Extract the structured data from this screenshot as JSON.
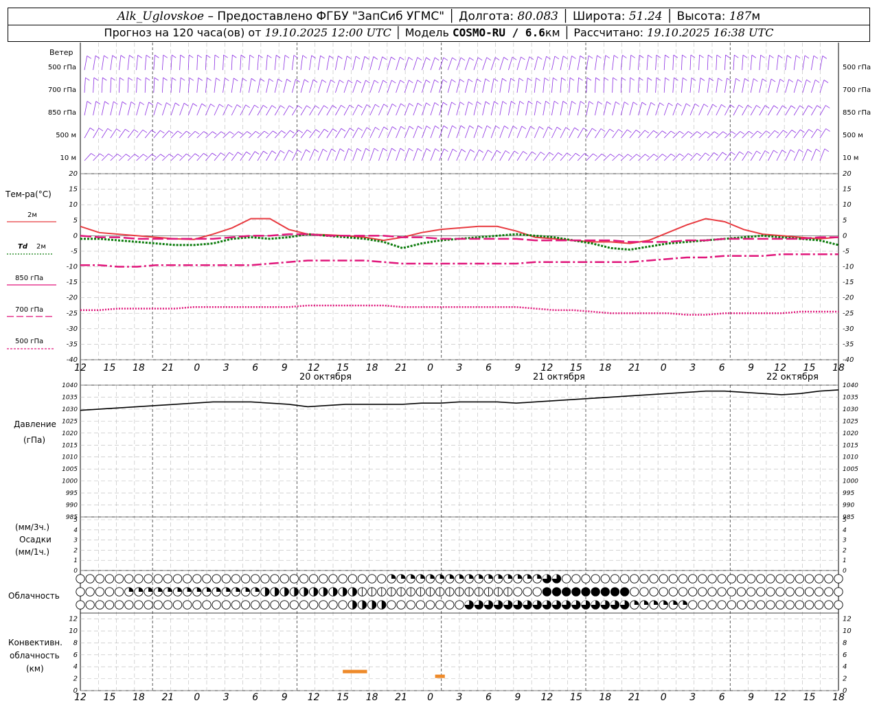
{
  "header": {
    "station": "Alk_Uglovskoe",
    "provider": "– Предоставлено ФГБУ \"ЗапСиб УГМС\"",
    "lon_label": "Долгота:",
    "lon": "80.083",
    "lat_label": "Широта:",
    "lat": "51.24",
    "alt_label": "Высота:",
    "alt": "187",
    "alt_unit": "м",
    "forecast_prefix": "Прогноз на 120 часа(ов) от",
    "run_time": "19.10.2025 12:00 UTC",
    "model_label": "Модель",
    "model": "COSMO-RU / 6.6",
    "model_unit": "км",
    "calc_label": "Рассчитано:",
    "calc_time": "19.10.2025 16:38 UTC"
  },
  "time_axis": {
    "hour_ticks": [
      "12",
      "15",
      "18",
      "21",
      "0",
      "3",
      "6",
      "9",
      "12",
      "15",
      "18",
      "21",
      "0",
      "3",
      "6",
      "9",
      "12",
      "15",
      "18",
      "21",
      "0",
      "3",
      "6",
      "9",
      "12",
      "15",
      "18"
    ],
    "dates": [
      "20 октября",
      "21 октября",
      "22 октября"
    ]
  },
  "wind_panel": {
    "title": "Ветер",
    "levels": [
      "500 гПа",
      "700 гПа",
      "850 гПа",
      "500 м",
      "10 м"
    ]
  },
  "colors": {
    "wind": "#8a2be2",
    "t2m": "#e8393f",
    "td2m": "#0a7a0a",
    "t850": "#e0157a",
    "t700": "#e0157a",
    "t500": "#e0157a",
    "pressure": "#000000",
    "convective": "#ee8a2a",
    "grid": "#b8b8b8"
  },
  "chart_data": [
    {
      "type": "line",
      "title": "Тем-ра(°C)",
      "x_hours": [
        0,
        3,
        6,
        9,
        12,
        15,
        18,
        21,
        24,
        27,
        30,
        33,
        36,
        39,
        42,
        45,
        48,
        51,
        54,
        57,
        60,
        63,
        66,
        69,
        72,
        75,
        78,
        81,
        84,
        87,
        90,
        93,
        96,
        99,
        102,
        105,
        108,
        111,
        114,
        117,
        120
      ],
      "ylim": [
        -40,
        20
      ],
      "yticks": [
        20,
        15,
        10,
        5,
        0,
        -5,
        -10,
        -15,
        -20,
        -25,
        -30,
        -35,
        -40
      ],
      "legend_title": "Тем-ра(°C)",
      "series": [
        {
          "name": "2м",
          "style": "solid",
          "values": [
            3,
            1,
            0.5,
            0,
            -0.5,
            -1,
            -1.2,
            0.5,
            2.5,
            5.5,
            5.5,
            2,
            0.5,
            0.3,
            0,
            -0.5,
            -1.5,
            -0.5,
            1,
            2,
            2.5,
            3,
            3,
            1.5,
            -0.5,
            -1,
            -1.5,
            -2,
            -2,
            -2.5,
            -1.5,
            1,
            3.5,
            5.5,
            4.5,
            2,
            0.5,
            0,
            -0.5,
            -1,
            -0.5
          ]
        },
        {
          "name": "Td 2м",
          "style": "dotted",
          "values": [
            -1,
            -1,
            -1.5,
            -2,
            -2.5,
            -3,
            -3,
            -2.5,
            -1,
            -0.5,
            -1,
            -0.5,
            0.5,
            0,
            -0.5,
            -1,
            -2,
            -4,
            -2.5,
            -1.5,
            -1,
            -0.5,
            0,
            0.5,
            0,
            -0.5,
            -1.5,
            -2.5,
            -4,
            -4.5,
            -3.5,
            -2.5,
            -2,
            -1.5,
            -1,
            -0.5,
            0,
            -0.5,
            -1,
            -1.5,
            -3
          ]
        },
        {
          "name": "850 гПа",
          "style": "dashdot",
          "values": [
            -9.5,
            -9.5,
            -10,
            -10,
            -9.5,
            -9.5,
            -9.5,
            -9.5,
            -9.5,
            -9.5,
            -9,
            -8.5,
            -8,
            -8,
            -8,
            -8,
            -8.5,
            -9,
            -9,
            -9,
            -9,
            -9,
            -9,
            -9,
            -8.5,
            -8.5,
            -8.5,
            -8.5,
            -8.5,
            -8.5,
            -8,
            -7.5,
            -7,
            -7,
            -6.5,
            -6.5,
            -6.5,
            -6,
            -6,
            -6,
            -6
          ]
        },
        {
          "name": "700 гПа",
          "style": "dashed",
          "values": [
            0,
            -0.5,
            -0.5,
            -1,
            -1,
            -1,
            -1,
            -1,
            -0.5,
            0,
            0,
            0.5,
            0.5,
            0,
            0,
            0,
            0,
            -0.5,
            -0.5,
            -1,
            -1,
            -1,
            -1,
            -1,
            -1.5,
            -1.5,
            -1.5,
            -1.5,
            -1.5,
            -2,
            -2,
            -2,
            -1.5,
            -1.5,
            -1,
            -1,
            -1,
            -1,
            -1,
            -0.5,
            -0.5
          ]
        },
        {
          "name": "500 гПа",
          "style": "densedot",
          "values": [
            -24,
            -24,
            -23.5,
            -23.5,
            -23.5,
            -23.5,
            -23,
            -23,
            -23,
            -23,
            -23,
            -23,
            -22.5,
            -22.5,
            -22.5,
            -22.5,
            -22.5,
            -23,
            -23,
            -23,
            -23,
            -23,
            -23,
            -23,
            -23.5,
            -24,
            -24,
            -24.5,
            -25,
            -25,
            -25,
            -25,
            -25.5,
            -25.5,
            -25,
            -25,
            -25,
            -25,
            -24.5,
            -24.5,
            -24.5
          ]
        }
      ]
    },
    {
      "type": "line",
      "title": "Давление",
      "ylabel": "(гПа)",
      "ylim": [
        985,
        1040
      ],
      "yticks": [
        1040,
        1035,
        1030,
        1025,
        1020,
        1015,
        1010,
        1005,
        1000,
        995,
        990,
        985
      ],
      "x_hours": [
        0,
        3,
        6,
        9,
        12,
        15,
        18,
        21,
        24,
        27,
        30,
        33,
        36,
        39,
        42,
        45,
        48,
        51,
        54,
        57,
        60,
        63,
        66,
        69,
        72,
        75,
        78,
        81,
        84,
        87,
        90,
        93,
        96,
        99,
        102,
        105,
        108,
        111,
        114,
        117,
        120
      ],
      "series": [
        {
          "name": "Давление",
          "values": [
            1029.5,
            1030,
            1030.5,
            1031,
            1031.5,
            1032,
            1032.5,
            1033,
            1033,
            1033,
            1032.5,
            1032,
            1031,
            1031.5,
            1032,
            1032,
            1032,
            1032,
            1032.5,
            1032.5,
            1033,
            1033,
            1033,
            1032.5,
            1033,
            1033.5,
            1034,
            1034.5,
            1035,
            1035.5,
            1036,
            1036.5,
            1037,
            1037.5,
            1037.5,
            1037,
            1036.5,
            1036,
            1036.5,
            1037.5,
            1038
          ]
        }
      ]
    },
    {
      "type": "bar",
      "title": "Осадки",
      "units": [
        "(мм/3ч.)",
        "(мм/1ч.)"
      ],
      "ylim": [
        0,
        5
      ],
      "yticks": [
        5,
        4,
        3,
        2,
        1,
        0
      ],
      "values": []
    },
    {
      "type": "table",
      "title": "Облачность",
      "note": "3 rows of hourly cloud cover symbols (0 empty – 8 full), high/middle/low",
      "rows": [
        {
          "segments": [
            [
              0,
              0,
              0
            ],
            [
              1,
              31,
              0
            ],
            [
              32,
              47,
              2
            ],
            [
              48,
              49,
              7
            ],
            [
              50,
              57,
              0
            ],
            [
              58,
              121,
              0
            ]
          ]
        },
        {
          "segments": [
            [
              0,
              4,
              0
            ],
            [
              5,
              11,
              2
            ],
            [
              12,
              18,
              2
            ],
            [
              19,
              28,
              3
            ],
            [
              29,
              44,
              1
            ],
            [
              45,
              47,
              0
            ],
            [
              48,
              56,
              8
            ],
            [
              57,
              121,
              0
            ]
          ]
        },
        {
          "segments": [
            [
              0,
              27,
              0
            ],
            [
              28,
              31,
              3
            ],
            [
              32,
              39,
              0
            ],
            [
              40,
              56,
              5
            ],
            [
              57,
              62,
              2
            ],
            [
              63,
              121,
              0
            ]
          ]
        }
      ]
    },
    {
      "type": "bar",
      "title": "Конвективн. облачность",
      "ylabel": "(км)",
      "ylim": [
        0,
        13
      ],
      "yticks": [
        12,
        10,
        8,
        6,
        4,
        2,
        0
      ],
      "series": [
        {
          "name": "cloud base/top",
          "bars": [
            {
              "x_start": 27,
              "x_end": 29.5,
              "y": 3.2
            },
            {
              "x_start": 36.5,
              "x_end": 37.5,
              "y": 2.4
            }
          ]
        }
      ]
    }
  ],
  "panels_labels": {
    "wind": "Ветер",
    "temp_title": "Тем-ра(°C)",
    "leg_2m": "2м",
    "leg_td": "Td",
    "leg_td2": "2м",
    "leg_850": "850 гПа",
    "leg_700": "700 гПа",
    "leg_500": "500 гПа",
    "pressure1": "Давление",
    "pressure2": "(гПа)",
    "precip1": "(мм/3ч.)",
    "precip2": "Осадки",
    "precip3": "(мм/1ч.)",
    "clouds": "Облачность",
    "conv1": "Конвективн.",
    "conv2": "облачность",
    "conv3": "(км)"
  }
}
